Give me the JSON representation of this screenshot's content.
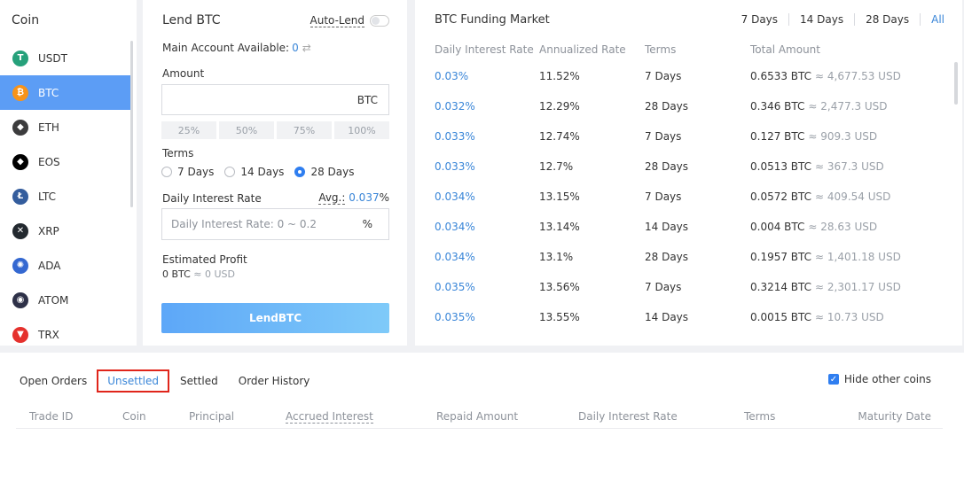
{
  "coin_panel": {
    "title": "Coin",
    "items": [
      {
        "label": "USDT",
        "icon": "usdt-icon",
        "glyph": "T",
        "color": "#26a17b",
        "active": false
      },
      {
        "label": "BTC",
        "icon": "btc-icon",
        "glyph": "₿",
        "color": "#f7931a",
        "active": true
      },
      {
        "label": "ETH",
        "icon": "eth-icon",
        "glyph": "◆",
        "color": "#3c3c3d",
        "active": false
      },
      {
        "label": "EOS",
        "icon": "eos-icon",
        "glyph": "◆",
        "color": "#000000",
        "active": false
      },
      {
        "label": "LTC",
        "icon": "ltc-icon",
        "glyph": "Ł",
        "color": "#345d9d",
        "active": false
      },
      {
        "label": "XRP",
        "icon": "xrp-icon",
        "glyph": "✕",
        "color": "#23292f",
        "active": false
      },
      {
        "label": "ADA",
        "icon": "ada-icon",
        "glyph": "✺",
        "color": "#3468d1",
        "active": false
      },
      {
        "label": "ATOM",
        "icon": "atom-icon",
        "glyph": "◉",
        "color": "#2e3148",
        "active": false
      },
      {
        "label": "TRX",
        "icon": "trx-icon",
        "glyph": "▼",
        "color": "#e5312d",
        "active": false
      }
    ]
  },
  "lend": {
    "title": "Lend BTC",
    "auto_lend": "Auto-Lend",
    "available_label": "Main Account Available:",
    "available_value": "0",
    "amount_label": "Amount",
    "amount_unit": "BTC",
    "percents": [
      "25%",
      "50%",
      "75%",
      "100%"
    ],
    "terms_label": "Terms",
    "terms": [
      {
        "label": "7 Days",
        "checked": false
      },
      {
        "label": "14 Days",
        "checked": false
      },
      {
        "label": "28 Days",
        "checked": true
      }
    ],
    "rate_label": "Daily Interest Rate",
    "avg_label": "Avg.:",
    "avg_value": "0.037",
    "avg_unit": "%",
    "rate_placeholder": "Daily Interest Rate: 0 ~ 0.2",
    "rate_unit": "%",
    "estimated_label": "Estimated Profit",
    "estimated_btc": "0 BTC",
    "estimated_usd": "≈ 0 USD",
    "button": "LendBTC"
  },
  "market": {
    "title": "BTC Funding Market",
    "filters": [
      "7 Days",
      "14 Days",
      "28 Days",
      "All"
    ],
    "columns": [
      "Daily Interest Rate",
      "Annualized Rate",
      "Terms",
      "Total Amount"
    ],
    "rows": [
      {
        "rate": "0.03%",
        "annual": "11.52%",
        "terms": "7 Days",
        "btc": "0.6533 BTC",
        "usd": "≈ 4,677.53 USD"
      },
      {
        "rate": "0.032%",
        "annual": "12.29%",
        "terms": "28 Days",
        "btc": "0.346 BTC",
        "usd": "≈ 2,477.3 USD"
      },
      {
        "rate": "0.033%",
        "annual": "12.74%",
        "terms": "7 Days",
        "btc": "0.127 BTC",
        "usd": "≈ 909.3 USD"
      },
      {
        "rate": "0.033%",
        "annual": "12.7%",
        "terms": "28 Days",
        "btc": "0.0513 BTC",
        "usd": "≈ 367.3 USD"
      },
      {
        "rate": "0.034%",
        "annual": "13.15%",
        "terms": "7 Days",
        "btc": "0.0572 BTC",
        "usd": "≈ 409.54 USD"
      },
      {
        "rate": "0.034%",
        "annual": "13.14%",
        "terms": "14 Days",
        "btc": "0.004 BTC",
        "usd": "≈ 28.63 USD"
      },
      {
        "rate": "0.034%",
        "annual": "13.1%",
        "terms": "28 Days",
        "btc": "0.1957 BTC",
        "usd": "≈ 1,401.18 USD"
      },
      {
        "rate": "0.035%",
        "annual": "13.56%",
        "terms": "7 Days",
        "btc": "0.3214 BTC",
        "usd": "≈ 2,301.17 USD"
      },
      {
        "rate": "0.035%",
        "annual": "13.55%",
        "terms": "14 Days",
        "btc": "0.0015 BTC",
        "usd": "≈ 10.73 USD"
      }
    ]
  },
  "orders": {
    "tabs": [
      {
        "label": "Open Orders",
        "active": false
      },
      {
        "label": "Unsettled",
        "active": true
      },
      {
        "label": "Settled",
        "active": false
      },
      {
        "label": "Order History",
        "active": false
      }
    ],
    "hide_other_coins": "Hide other coins",
    "columns": [
      "Trade ID",
      "Coin",
      "Principal",
      "Accrued Interest",
      "Repaid Amount",
      "Daily Interest Rate",
      "Terms",
      "Maturity Date"
    ]
  }
}
